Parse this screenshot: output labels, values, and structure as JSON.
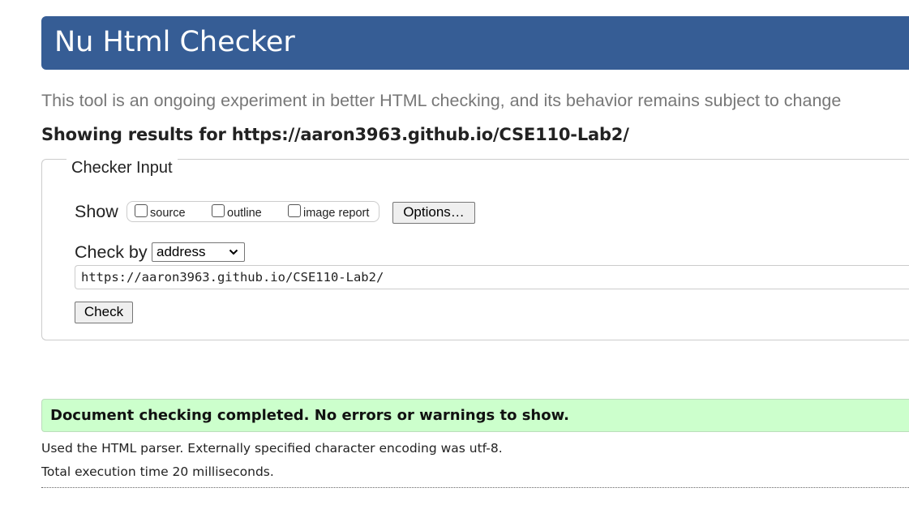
{
  "header": {
    "title": "Nu Html Checker"
  },
  "intro": "This tool is an ongoing experiment in better HTML checking, and its behavior remains subject to change",
  "results_heading": "Showing results for https://aaron3963.github.io/CSE110-Lab2/",
  "checker_input": {
    "legend": "Checker Input",
    "show_label": "Show",
    "show_options": [
      {
        "label": "source",
        "checked": false
      },
      {
        "label": "outline",
        "checked": false
      },
      {
        "label": "image report",
        "checked": false
      }
    ],
    "options_button": "Options…",
    "check_by_label": "Check by",
    "check_by_selected": "address",
    "url_value": "https://aaron3963.github.io/CSE110-Lab2/",
    "check_button": "Check"
  },
  "result": {
    "success_message": "Document checking completed. No errors or warnings to show.",
    "parser_info": "Used the HTML parser. Externally specified character encoding was utf-8.",
    "execution_time": "Total execution time 20 milliseconds."
  },
  "colors": {
    "header_bg": "#365d95",
    "success_bg": "#ccffcc",
    "intro_text": "#777777"
  }
}
